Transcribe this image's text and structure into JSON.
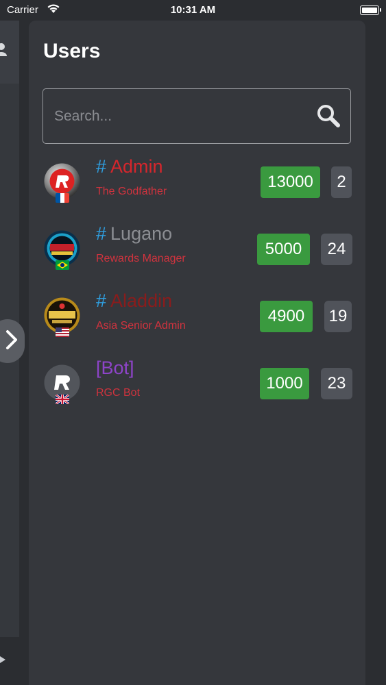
{
  "status_bar": {
    "carrier": "Carrier",
    "time": "10:31 AM"
  },
  "panel": {
    "title": "Users"
  },
  "search": {
    "placeholder": "Search..."
  },
  "colors": {
    "admin_red": "#d6262c",
    "role_red": "#d0333e",
    "lugano_gray": "#8b8d92",
    "aladdin_darkred": "#8a1c1c",
    "bot_purple": "#8e44c9",
    "points_green": "#3a9a3f",
    "hash_blue": "#2f9fe0"
  },
  "users": [
    {
      "hash": "#",
      "name": "Admin",
      "role": "The Godfather",
      "points": "13000",
      "count": "2",
      "flag": "france"
    },
    {
      "hash": "#",
      "name": "Lugano",
      "role": "Rewards Manager",
      "points": "5000",
      "count": "24",
      "flag": "brazil"
    },
    {
      "hash": "#",
      "name": "Aladdin",
      "role": "Asia Senior Admin",
      "points": "4900",
      "count": "19",
      "flag": "usa"
    },
    {
      "hash": "",
      "name": "[Bot]",
      "role": "RGC Bot",
      "points": "1000",
      "count": "23",
      "flag": "uk"
    }
  ]
}
